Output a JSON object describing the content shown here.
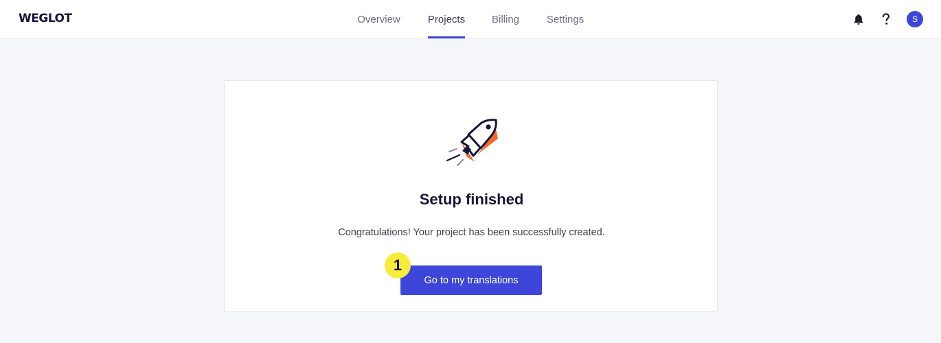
{
  "header": {
    "logo": "WEGLOT",
    "nav": [
      {
        "label": "Overview",
        "active": false
      },
      {
        "label": "Projects",
        "active": true
      },
      {
        "label": "Billing",
        "active": false
      },
      {
        "label": "Settings",
        "active": false
      }
    ],
    "icons": [
      "bell-icon",
      "help-icon"
    ],
    "avatar_initial": "S"
  },
  "main": {
    "illustration": "rocket-icon",
    "title": "Setup finished",
    "message": "Congratulations! Your project has been successfully created.",
    "button_label": "Go to my translations"
  },
  "annotation": {
    "step": "1",
    "color": "#f7eb3c"
  },
  "colors": {
    "accent": "#3d46d8",
    "background": "#f5f6f9",
    "rocket_orange": "#f26b2b",
    "navy": "#16163a"
  }
}
